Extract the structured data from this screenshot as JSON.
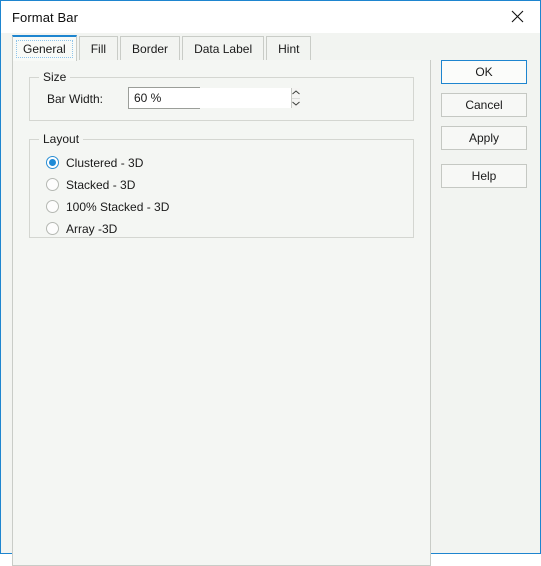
{
  "window": {
    "title": "Format Bar",
    "close_icon": "close-icon",
    "accent_color": "#1e85cf",
    "background_color": "#f2f4f1"
  },
  "tabs": [
    {
      "label": "General",
      "active": true
    },
    {
      "label": "Fill",
      "active": false
    },
    {
      "label": "Border",
      "active": false
    },
    {
      "label": "Data Label",
      "active": false
    },
    {
      "label": "Hint",
      "active": false
    }
  ],
  "general_page": {
    "size_group": {
      "title": "Size",
      "bar_width_label": "Bar Width:",
      "bar_width_value": "60 %",
      "bar_width_placeholder": "",
      "spinner_up_icon": "chevron-up-icon",
      "spinner_down_icon": "chevron-down-icon"
    },
    "layout_group": {
      "title": "Layout",
      "options": [
        {
          "label": "Clustered - 3D",
          "selected": true
        },
        {
          "label": "Stacked - 3D",
          "selected": false
        },
        {
          "label": "100% Stacked - 3D",
          "selected": false
        },
        {
          "label": "Array -3D",
          "selected": false
        }
      ],
      "selected_color": "#1e8ad6"
    }
  },
  "buttons": {
    "ok": "OK",
    "cancel": "Cancel",
    "apply": "Apply",
    "help": "Help"
  }
}
